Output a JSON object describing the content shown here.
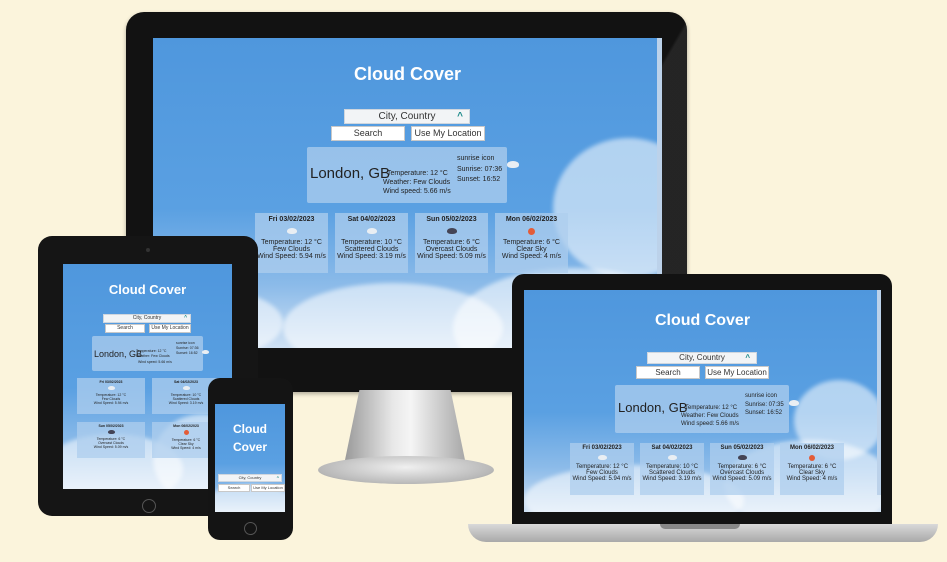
{
  "app": {
    "title": "Cloud Cover",
    "title_phone_line1": "Cloud",
    "title_phone_line2": "Cover",
    "search_placeholder": "City, Country",
    "search_button": "Search",
    "location_button": "Use My Location"
  },
  "current": {
    "city": "London, GB",
    "temperature": "Temperature: 12 °C",
    "weather": "Weather: Few Clouds",
    "wind": "Wind speed: 5.66 m/s",
    "sunrise_alt": "sunrise icon",
    "sunrise": "Sunrise: 07:36",
    "sunset": "Sunset: 16:52"
  },
  "tablet_current": {
    "temperature": "Temperature: 12 °C",
    "weather": "Weather: Few Clouds",
    "wind": "Wind speed: 5.66 m/s",
    "sunrise_alt": "sunrise icon",
    "sunrise": "Sunrise: 07:36",
    "sunset": "Sunset: 16:52"
  },
  "forecast": [
    {
      "date": "Fri 03/02/2023",
      "temp": "Temperature: 12 °C",
      "desc": "Few Clouds",
      "wind": "Wind Speed: 5.94 m/s",
      "icon": "few-clouds-icon"
    },
    {
      "date": "Sat 04/02/2023",
      "temp": "Temperature: 10 °C",
      "desc": "Scattered Clouds",
      "wind": "Wind Speed: 3.19 m/s",
      "icon": "scattered-clouds-icon"
    },
    {
      "date": "Sun 05/02/2023",
      "temp": "Temperature: 6 °C",
      "desc": "Overcast Clouds",
      "wind": "Wind Speed: 5.09 m/s",
      "icon": "overcast-clouds-icon"
    },
    {
      "date": "Mon 06/02/2023",
      "temp": "Temperature: 6 °C",
      "desc": "Clear Sky",
      "wind": "Wind Speed: 4 m/s",
      "icon": "clear-sky-icon"
    }
  ],
  "laptop": {
    "wind": "Wind speed: 5.66 m/s",
    "sunrise": "Sunrise: 07:35",
    "sunset": "Sunset: 16:52"
  },
  "colors": {
    "sky": "#4f97dd",
    "card": "#adcdee",
    "sun": "#e35c38",
    "background": "#fbf4dc"
  }
}
